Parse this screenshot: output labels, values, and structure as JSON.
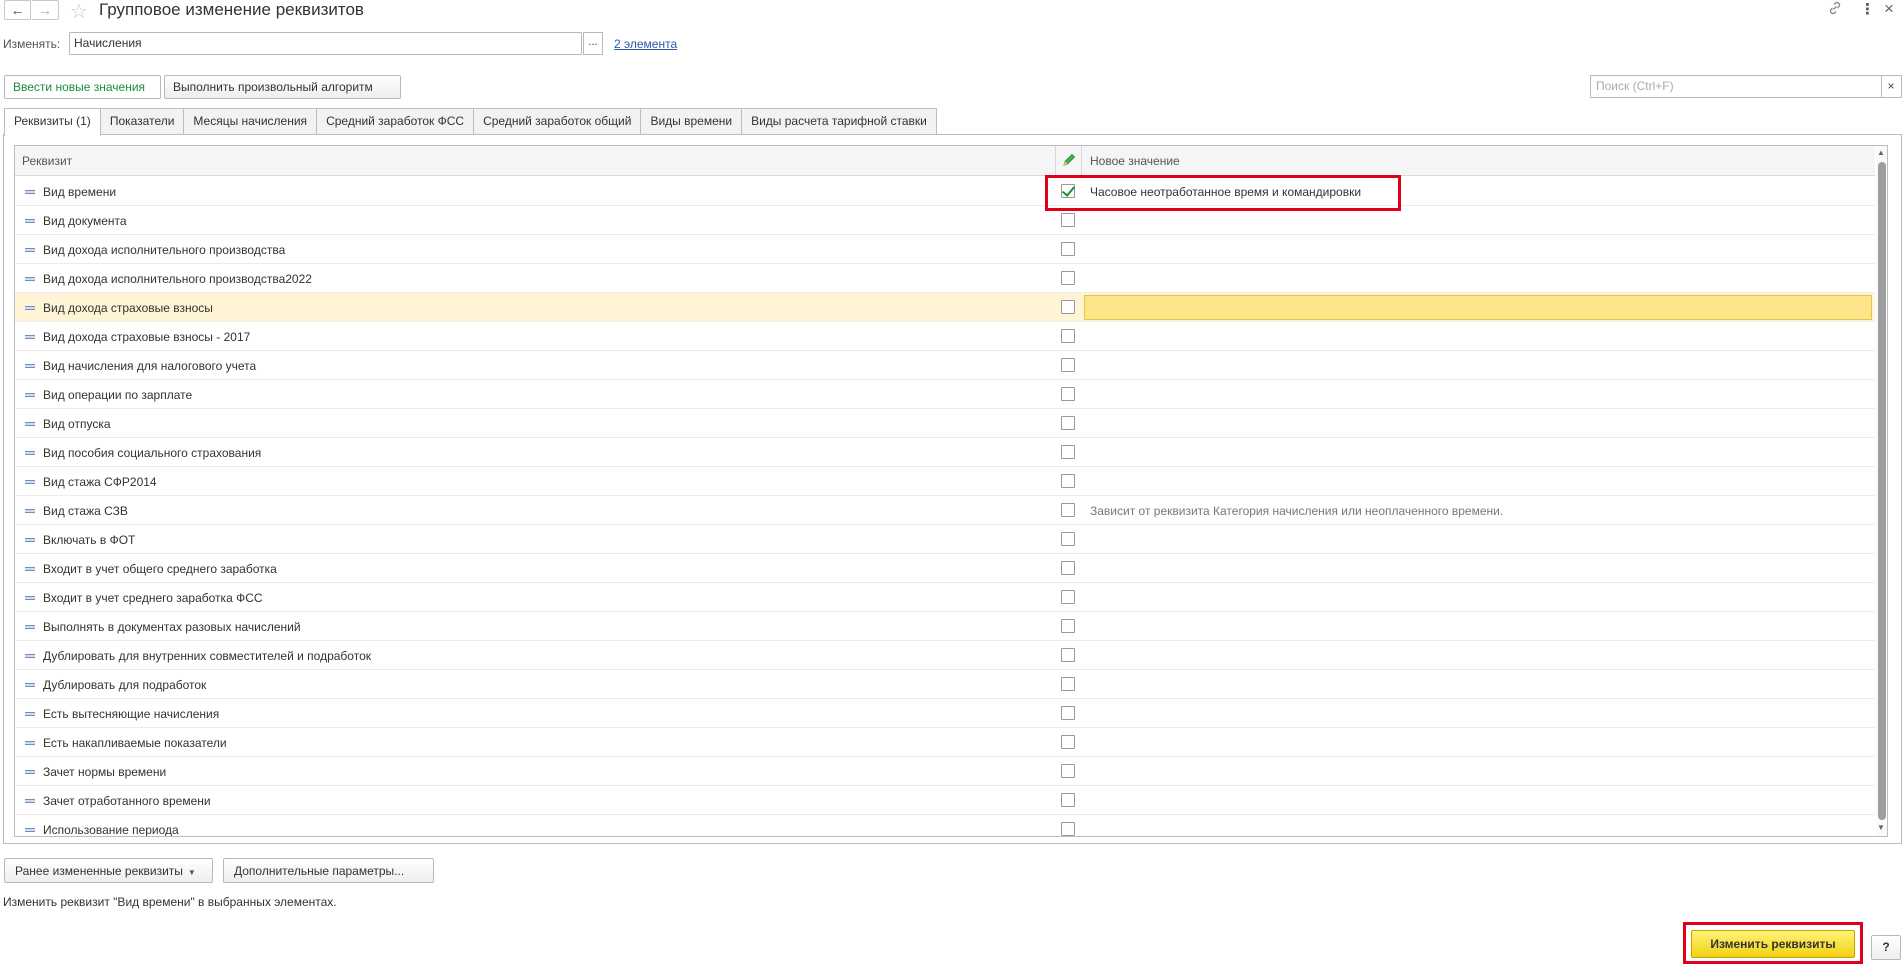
{
  "window": {
    "title": "Групповое изменение реквизитов",
    "back_icon": "←",
    "forward_icon": "→",
    "star_icon": "☆",
    "link_icon": "🔗",
    "more_icon": "⋮",
    "close_icon": "×"
  },
  "change": {
    "label": "Изменять:",
    "value": "Начисления",
    "choose_label": "...",
    "elements_link": "2 элемента"
  },
  "modes": {
    "new_values": "Ввести новые значения",
    "custom_algorithm": "Выполнить произвольный алгоритм"
  },
  "search": {
    "placeholder": "Поиск (Ctrl+F)",
    "clear_icon": "×"
  },
  "tabs": [
    {
      "label": "Реквизиты (1)"
    },
    {
      "label": "Показатели"
    },
    {
      "label": "Месяцы начисления"
    },
    {
      "label": "Средний заработок ФСС"
    },
    {
      "label": "Средний заработок общий"
    },
    {
      "label": "Виды времени"
    },
    {
      "label": "Виды расчета тарифной ставки"
    }
  ],
  "grid": {
    "col_requisite": "Реквизит",
    "col_new_value": "Новое значение",
    "rows": [
      {
        "label": "Вид времени",
        "checked": true,
        "value": "Часовое неотработанное время и командировки",
        "hint": false,
        "selected": false
      },
      {
        "label": "Вид документа",
        "checked": false,
        "value": "",
        "hint": false,
        "selected": false
      },
      {
        "label": "Вид дохода исполнительного производства",
        "checked": false,
        "value": "",
        "hint": false,
        "selected": false
      },
      {
        "label": "Вид дохода исполнительного производства2022",
        "checked": false,
        "value": "",
        "hint": false,
        "selected": false
      },
      {
        "label": "Вид дохода страховые взносы",
        "checked": false,
        "value": "",
        "hint": false,
        "selected": true
      },
      {
        "label": "Вид дохода страховые взносы - 2017",
        "checked": false,
        "value": "",
        "hint": false,
        "selected": false
      },
      {
        "label": "Вид начисления для налогового учета",
        "checked": false,
        "value": "",
        "hint": false,
        "selected": false
      },
      {
        "label": "Вид операции по зарплате",
        "checked": false,
        "value": "",
        "hint": false,
        "selected": false
      },
      {
        "label": "Вид отпуска",
        "checked": false,
        "value": "",
        "hint": false,
        "selected": false
      },
      {
        "label": "Вид пособия социального страхования",
        "checked": false,
        "value": "",
        "hint": false,
        "selected": false
      },
      {
        "label": "Вид стажа  СФР2014",
        "checked": false,
        "value": "",
        "hint": false,
        "selected": false
      },
      {
        "label": "Вид стажа СЗВ",
        "checked": false,
        "value": "Зависит от реквизита Категория начисления или неоплаченного времени.",
        "hint": true,
        "selected": false
      },
      {
        "label": "Включать в ФОТ",
        "checked": false,
        "value": "",
        "hint": false,
        "selected": false
      },
      {
        "label": "Входит в учет общего среднего заработка",
        "checked": false,
        "value": "",
        "hint": false,
        "selected": false
      },
      {
        "label": "Входит в учет среднего заработка ФСС",
        "checked": false,
        "value": "",
        "hint": false,
        "selected": false
      },
      {
        "label": "Выполнять в документах разовых начислений",
        "checked": false,
        "value": "",
        "hint": false,
        "selected": false
      },
      {
        "label": "Дублировать для внутренних совместителей и подработок",
        "checked": false,
        "value": "",
        "hint": false,
        "selected": false
      },
      {
        "label": "Дублировать для подработок",
        "checked": false,
        "value": "",
        "hint": false,
        "selected": false
      },
      {
        "label": "Есть вытесняющие начисления",
        "checked": false,
        "value": "",
        "hint": false,
        "selected": false
      },
      {
        "label": "Есть накапливаемые показатели",
        "checked": false,
        "value": "",
        "hint": false,
        "selected": false
      },
      {
        "label": "Зачет нормы времени",
        "checked": false,
        "value": "",
        "hint": false,
        "selected": false
      },
      {
        "label": "Зачет отработанного времени",
        "checked": false,
        "value": "",
        "hint": false,
        "selected": false
      },
      {
        "label": "Использование периода",
        "checked": false,
        "value": "",
        "hint": false,
        "selected": false
      }
    ]
  },
  "bottom": {
    "prev_changed": "Ранее измененные реквизиты",
    "extra_params": "Дополнительные параметры...",
    "status": "Изменить реквизит \"Вид времени\" в выбранных элементах.",
    "apply": "Изменить реквизиты",
    "help": "?"
  }
}
